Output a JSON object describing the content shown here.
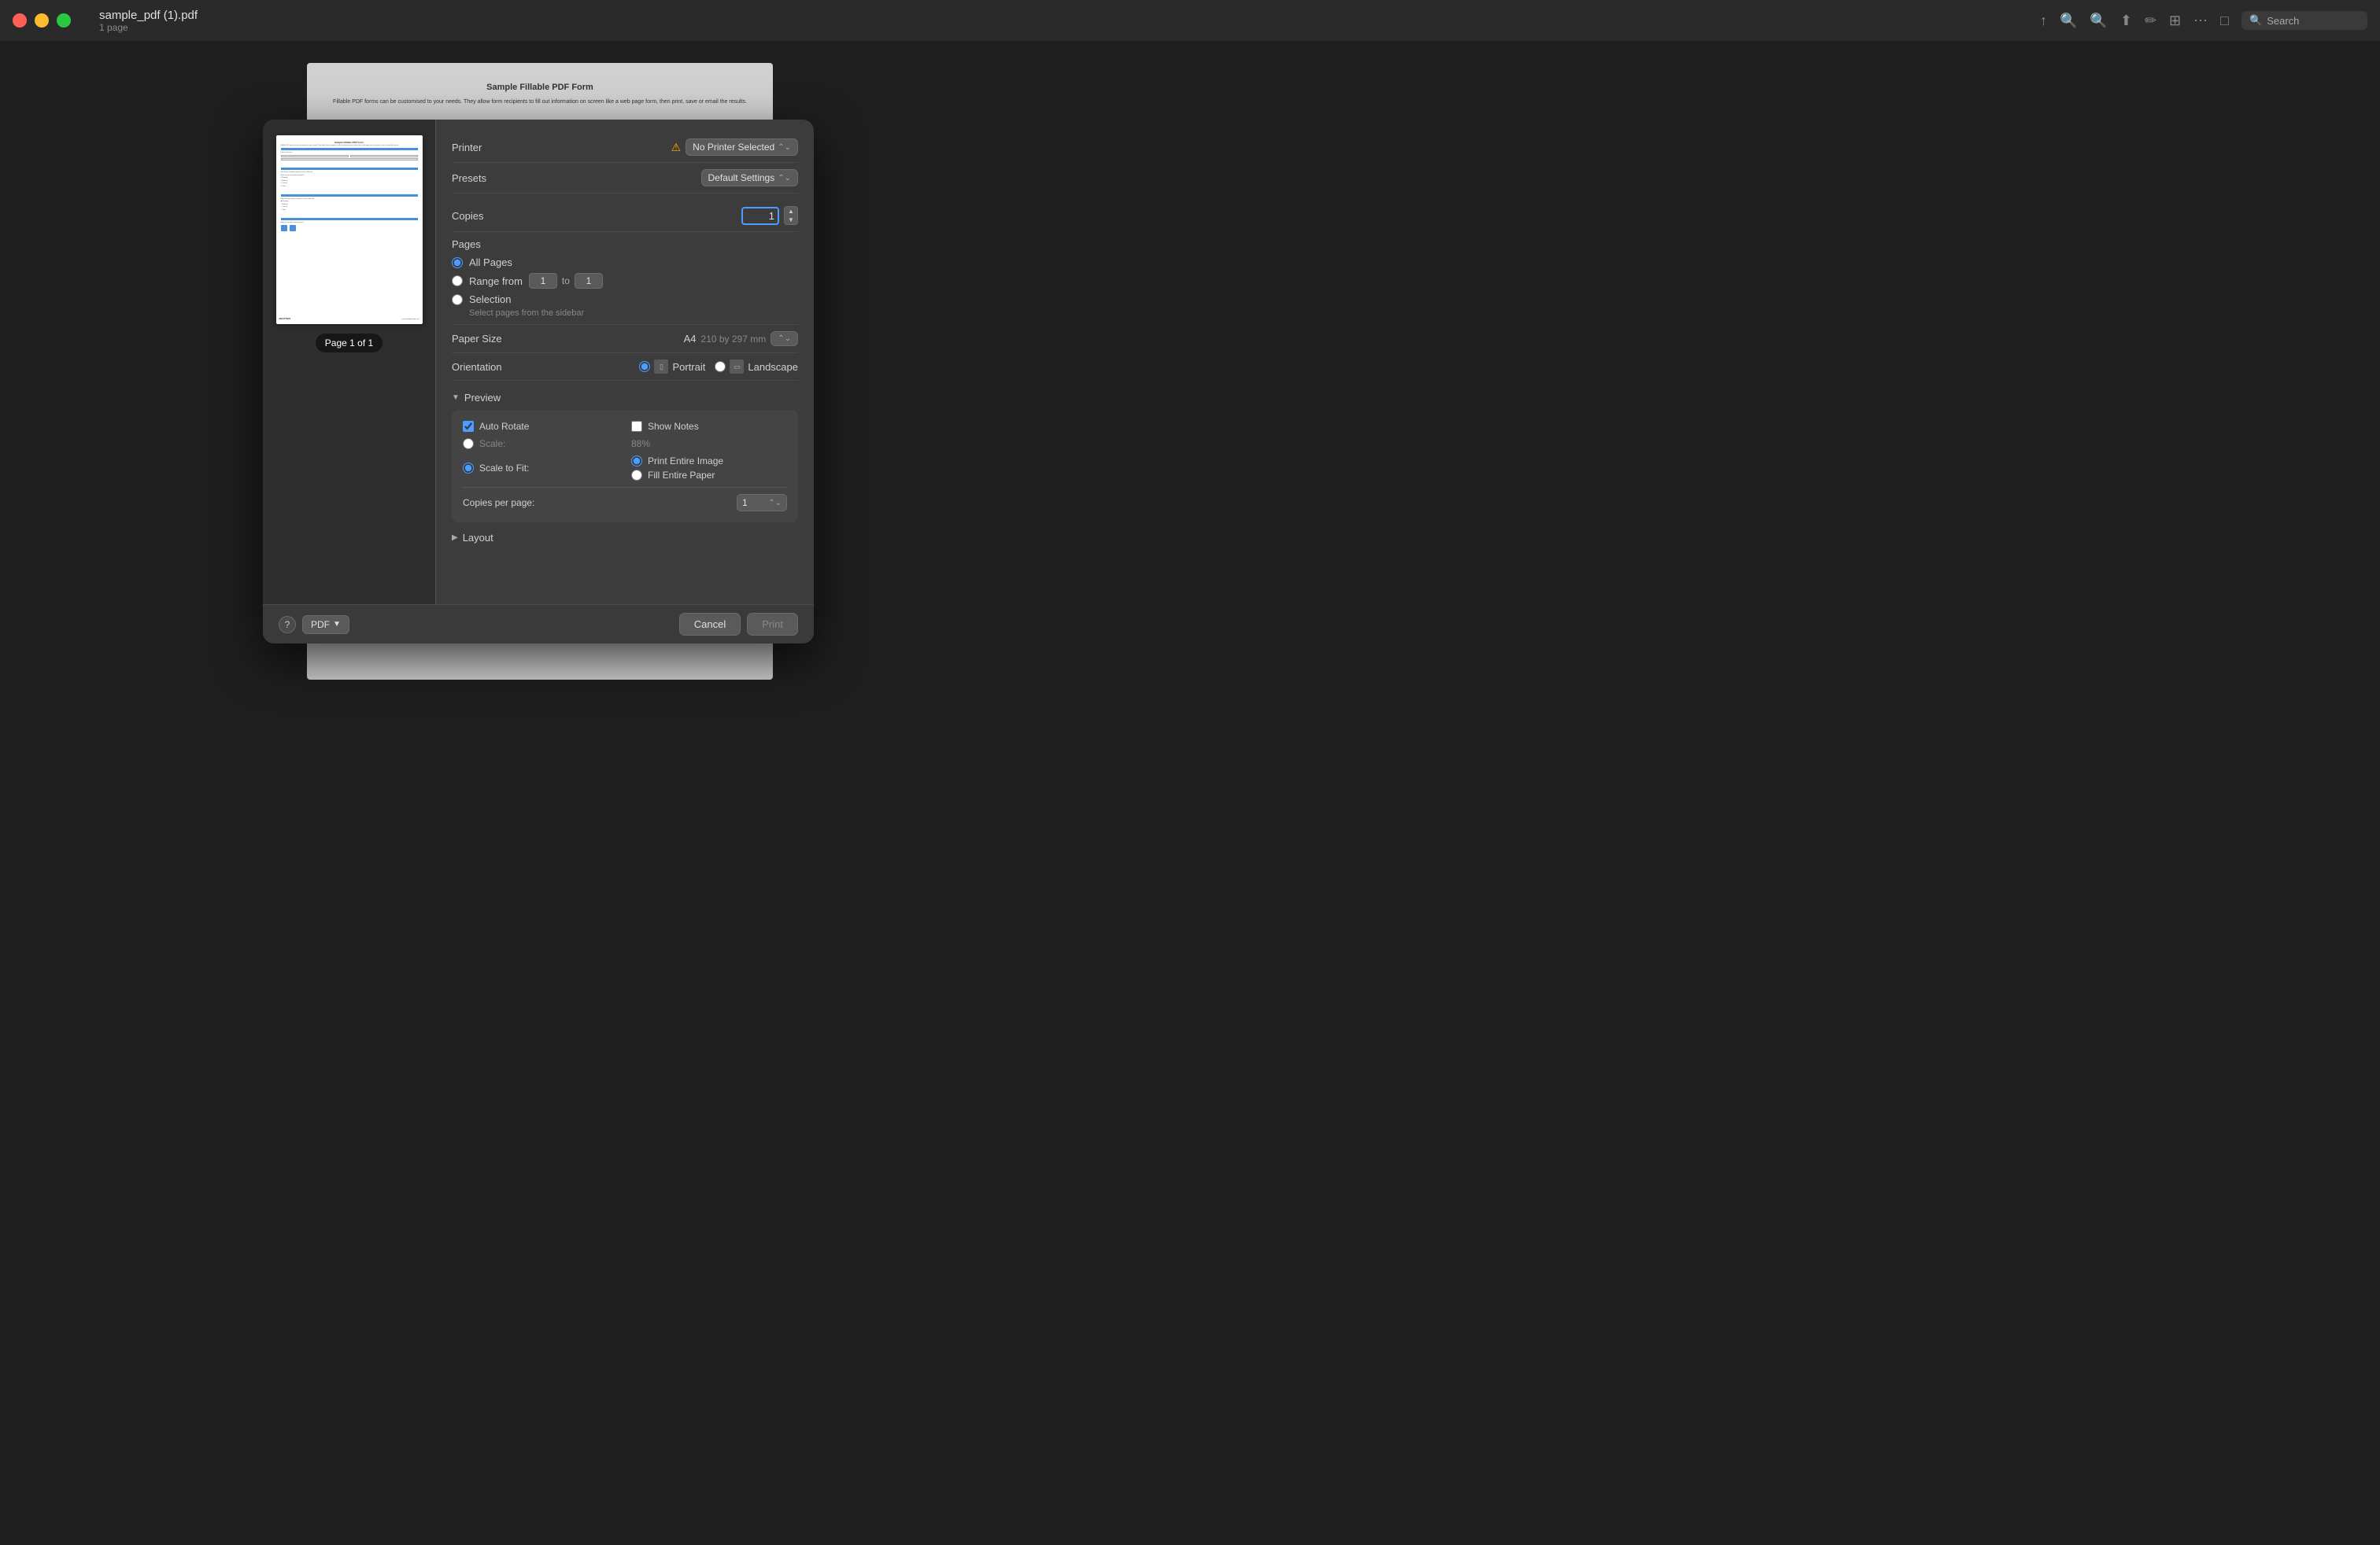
{
  "titlebar": {
    "title": "sample_pdf (1).pdf",
    "subtitle": "1 page",
    "search_placeholder": "Search"
  },
  "dialog": {
    "printer": {
      "label": "Printer",
      "value": "No Printer Selected",
      "warning": "⚠"
    },
    "presets": {
      "label": "Presets",
      "value": "Default Settings"
    },
    "copies": {
      "label": "Copies",
      "value": "1"
    },
    "pages": {
      "label": "Pages",
      "options": {
        "all": "All Pages",
        "range": "Range from",
        "range_from": "1",
        "range_to_label": "to",
        "range_to": "1",
        "selection": "Selection",
        "selection_hint": "Select pages from the sidebar"
      }
    },
    "paper_size": {
      "label": "Paper Size",
      "value": "A4",
      "dims": "210 by 297 mm"
    },
    "orientation": {
      "label": "Orientation",
      "portrait": "Portrait",
      "landscape": "Landscape"
    },
    "preview": {
      "label": "Preview",
      "auto_rotate": "Auto Rotate",
      "show_notes": "Show Notes",
      "scale": "Scale:",
      "scale_value": "88%",
      "scale_to_fit": "Scale to Fit:",
      "print_entire_image": "Print Entire Image",
      "fill_entire_paper": "Fill Entire Paper",
      "copies_per_page_label": "Copies per page:",
      "copies_per_page_value": "1"
    },
    "layout": {
      "label": "Layout"
    },
    "buttons": {
      "help": "?",
      "pdf": "PDF",
      "cancel": "Cancel",
      "print": "Print"
    }
  },
  "page_indicator": "Page 1 of 1"
}
